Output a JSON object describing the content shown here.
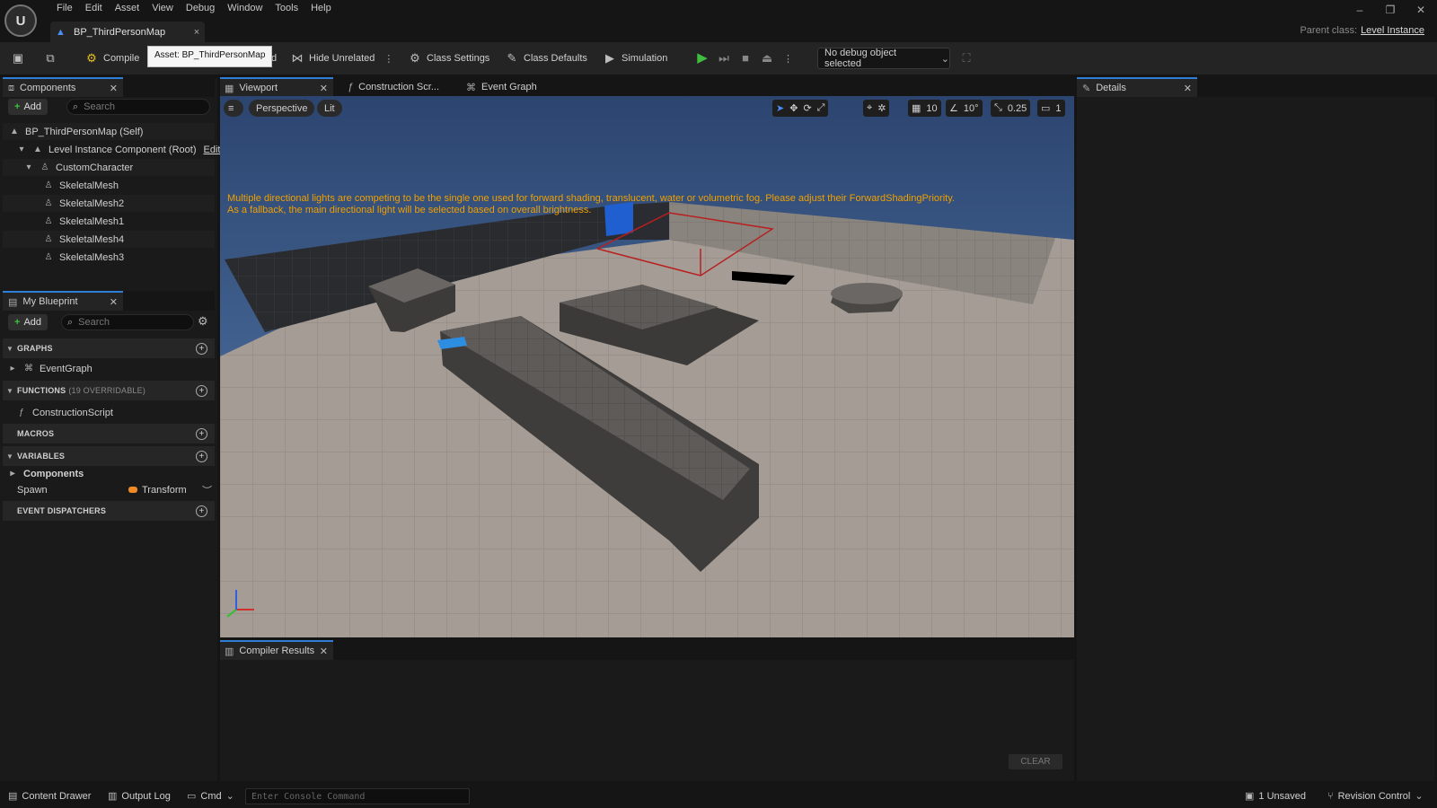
{
  "menu": [
    "File",
    "Edit",
    "Asset",
    "View",
    "Debug",
    "Window",
    "Tools",
    "Help"
  ],
  "doc_tab": {
    "title": "BP_ThirdPersonMap",
    "close": "×"
  },
  "window_controls": {
    "minimize": "–",
    "restore": "❐",
    "close": "✕"
  },
  "parent_class": {
    "label": "Parent class:",
    "value": "Level Instance"
  },
  "toolbar": {
    "compile": "Compile",
    "tooltip": "Asset: BP_ThirdPersonMap",
    "hidden_suffix": "d",
    "hide_unrelated": "Hide Unrelated",
    "class_settings": "Class Settings",
    "class_defaults": "Class Defaults",
    "simulation": "Simulation",
    "debug_object": "No debug object selected"
  },
  "components_panel": {
    "tab": "Components",
    "add": "Add",
    "search_placeholder": "Search",
    "tree": [
      {
        "label": "BP_ThirdPersonMap (Self)"
      },
      {
        "label": "Level Instance Component (Root)",
        "action": "Edit i"
      },
      {
        "label": "CustomCharacter"
      },
      {
        "label": "SkeletalMesh"
      },
      {
        "label": "SkeletalMesh2"
      },
      {
        "label": "SkeletalMesh1"
      },
      {
        "label": "SkeletalMesh4"
      },
      {
        "label": "SkeletalMesh3"
      }
    ]
  },
  "my_blueprint": {
    "tab": "My Blueprint",
    "add": "Add",
    "search_placeholder": "Search",
    "graphs": "GRAPHS",
    "event_graph": "EventGraph",
    "functions": "FUNCTIONS",
    "functions_sub": "(19 OVERRIDABLE)",
    "construction_script": "ConstructionScript",
    "macros": "MACROS",
    "variables": "VARIABLES",
    "components_cat": "Components",
    "spawn": "Spawn",
    "spawn_type": "Transform",
    "event_dispatchers": "EVENT DISPATCHERS"
  },
  "center_tabs": [
    "Viewport",
    "Construction Scr...",
    "Event Graph"
  ],
  "viewport": {
    "perspective": "Perspective",
    "lit": "Lit",
    "grid_snap": "10",
    "rot_snap": "10°",
    "scale_snap": "0.25",
    "camera_speed": "1",
    "warning_line1": "Multiple directional lights are competing to be the single one used for forward shading, translucent, water or volumetric fog. Please adjust their ForwardShadingPriority.",
    "warning_line2": "As a fallback, the main directional light will be selected based on overall brightness."
  },
  "compiler": {
    "tab": "Compiler Results",
    "clear": "CLEAR"
  },
  "details": {
    "tab": "Details"
  },
  "statusbar": {
    "content_drawer": "Content Drawer",
    "output_log": "Output Log",
    "cmd": "Cmd",
    "console_placeholder": "Enter Console Command",
    "unsaved": "1 Unsaved",
    "revision_control": "Revision Control"
  },
  "colors": {
    "accent": "#2f7fd9",
    "play": "#3fbf3f",
    "warning": "#f0a000",
    "transform_pin": "#f08a24"
  }
}
